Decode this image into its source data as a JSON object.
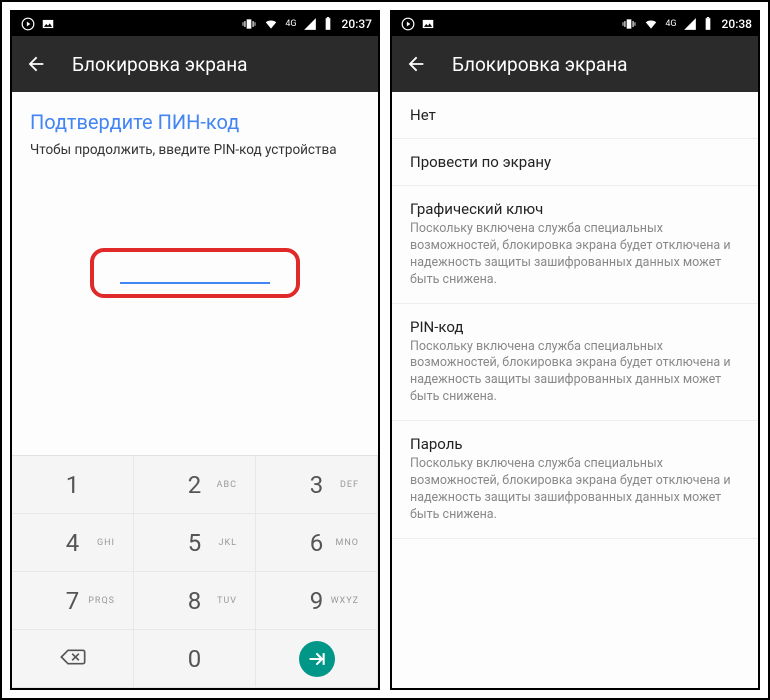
{
  "left": {
    "status_time": "20:37",
    "net_label": "4G",
    "appbar_title": "Блокировка экрана",
    "heading": "Подтвердите ПИН-код",
    "instruction": "Чтобы продолжить, введите PIN-код устройства",
    "keys": {
      "k1": {
        "d": "1",
        "l": ""
      },
      "k2": {
        "d": "2",
        "l": "ABC"
      },
      "k3": {
        "d": "3",
        "l": "DEF"
      },
      "k4": {
        "d": "4",
        "l": "GHI"
      },
      "k5": {
        "d": "5",
        "l": "JKL"
      },
      "k6": {
        "d": "6",
        "l": "MNO"
      },
      "k7": {
        "d": "7",
        "l": "PRQS"
      },
      "k8": {
        "d": "8",
        "l": "TUV"
      },
      "k9": {
        "d": "9",
        "l": "WXYZ"
      },
      "k0": {
        "d": "0",
        "l": ""
      }
    }
  },
  "right": {
    "status_time": "20:38",
    "net_label": "4G",
    "appbar_title": "Блокировка экрана",
    "options": {
      "none": {
        "title": "Нет"
      },
      "swipe": {
        "title": "Провести по экрану"
      },
      "pattern": {
        "title": "Графический ключ",
        "desc": "Поскольку включена служба специальных возможностей, блокировка экрана будет отключена и надежность защиты зашифрованных данных может быть снижена."
      },
      "pin": {
        "title": "PIN-код",
        "desc": "Поскольку включена служба специальных возможностей, блокировка экрана будет отключена и надежность защиты зашифрованных данных может быть снижена."
      },
      "pass": {
        "title": "Пароль",
        "desc": "Поскольку включена служба специальных возможностей, блокировка экрана будет отключена и надежность защиты зашифрованных данных может быть снижена."
      }
    }
  }
}
